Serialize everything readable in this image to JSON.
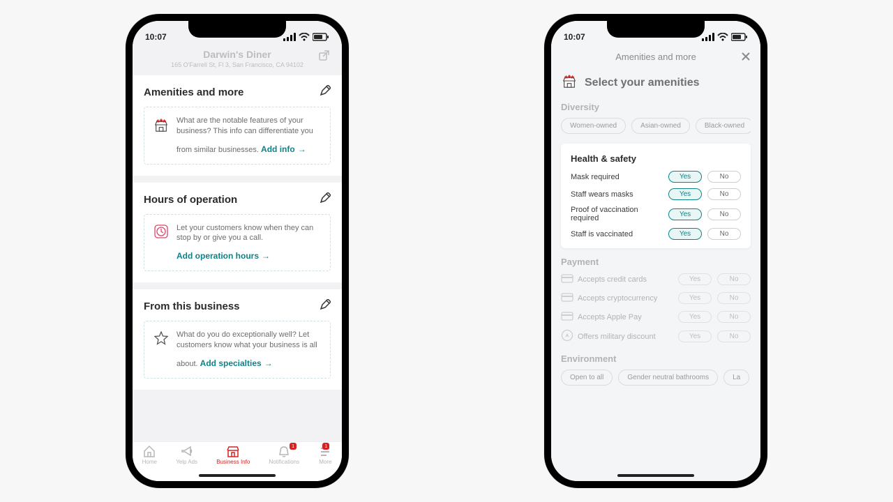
{
  "status": {
    "time": "10:07"
  },
  "leftPhone": {
    "header": {
      "title": "Darwin's Diner",
      "subtitle": "165 O'Farrell St, Fl 3, San Francisco, CA 94102"
    },
    "sections": {
      "amenities": {
        "title": "Amenities and more",
        "desc": "What are the notable features of your business? This info can differentiate you from similar businesses.",
        "cta": "Add info"
      },
      "hours": {
        "title": "Hours of operation",
        "desc": "Let your customers know when they can stop by or give you a call.",
        "cta": "Add operation hours"
      },
      "from": {
        "title": "From this business",
        "desc": "What do you do exceptionally well? Let customers know what your business is all about.",
        "cta": "Add specialties"
      }
    },
    "tabs": {
      "home": "Home",
      "yelpAds": "Yelp Ads",
      "bizInfo": "Business Info",
      "notifications": "Notifications",
      "more": "More",
      "badge_notif": "1",
      "badge_more": "1"
    }
  },
  "rightPhone": {
    "header": {
      "title": "Amenities and more"
    },
    "pageTitle": "Select your amenities",
    "diversity": {
      "title": "Diversity",
      "chips": {
        "c0": "Women-owned",
        "c1": "Asian-owned",
        "c2": "Black-owned"
      }
    },
    "health": {
      "title": "Health & safety",
      "rows": {
        "r0": {
          "label": "Mask required",
          "yes": "Yes",
          "no": "No"
        },
        "r1": {
          "label": "Staff wears masks",
          "yes": "Yes",
          "no": "No"
        },
        "r2": {
          "label": "Proof of vaccination required",
          "yes": "Yes",
          "no": "No"
        },
        "r3": {
          "label": "Staff is vaccinated",
          "yes": "Yes",
          "no": "No"
        }
      }
    },
    "payment": {
      "title": "Payment",
      "rows": {
        "r0": {
          "label": "Accepts credit cards",
          "yes": "Yes",
          "no": "No"
        },
        "r1": {
          "label": "Accepts cryptocurrency",
          "yes": "Yes",
          "no": "No"
        },
        "r2": {
          "label": "Accepts Apple Pay",
          "yes": "Yes",
          "no": "No"
        },
        "r3": {
          "label": "Offers military discount",
          "yes": "Yes",
          "no": "No"
        }
      }
    },
    "environment": {
      "title": "Environment",
      "chips": {
        "c0": "Open to all",
        "c1": "Gender neutral bathrooms",
        "c2": "La"
      }
    }
  }
}
